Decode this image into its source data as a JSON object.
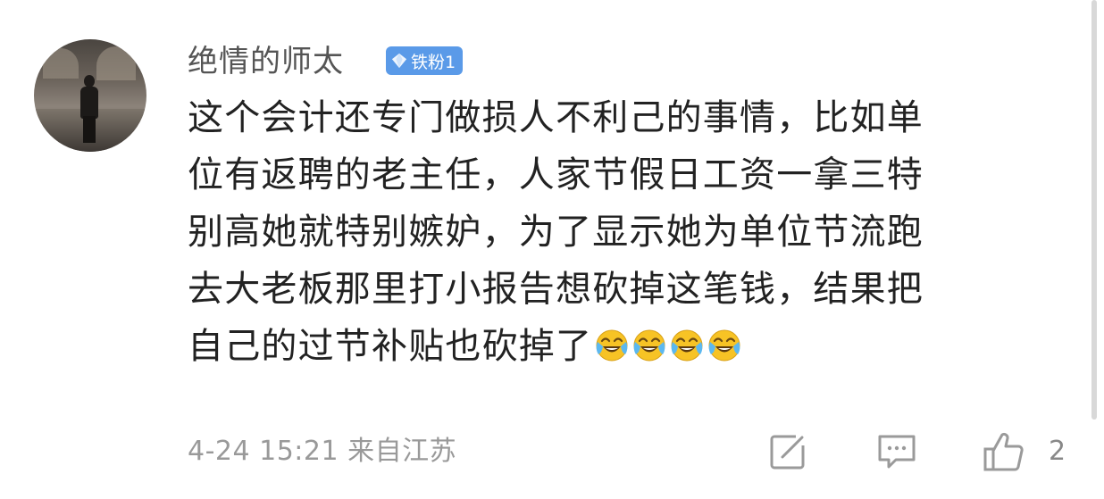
{
  "comment": {
    "username": "绝情的师太",
    "badge": "铁粉1",
    "lines": [
      "这个会计还专门做损人不利己的事情，比如单",
      "位有返聘的老主任，人家节假日工资一拿三特",
      "别高她就特别嫉妒，为了显示她为单位节流跑",
      "去大老板那里打小报告想砍掉这笔钱，结果把",
      "自己的过节补贴也砍掉了"
    ],
    "emojis": [
      "laugh-cry-icon",
      "laugh-cry-icon",
      "laugh-cry-icon",
      "laugh-cry-icon"
    ],
    "meta": "4-24 15:21 来自江苏",
    "like_count": "2"
  },
  "icons": {
    "share": "share-icon",
    "reply": "comment-icon",
    "like": "thumbs-up-icon"
  },
  "colors": {
    "badge": "#5a9ae8",
    "text": "#222222",
    "muted": "#999999"
  }
}
